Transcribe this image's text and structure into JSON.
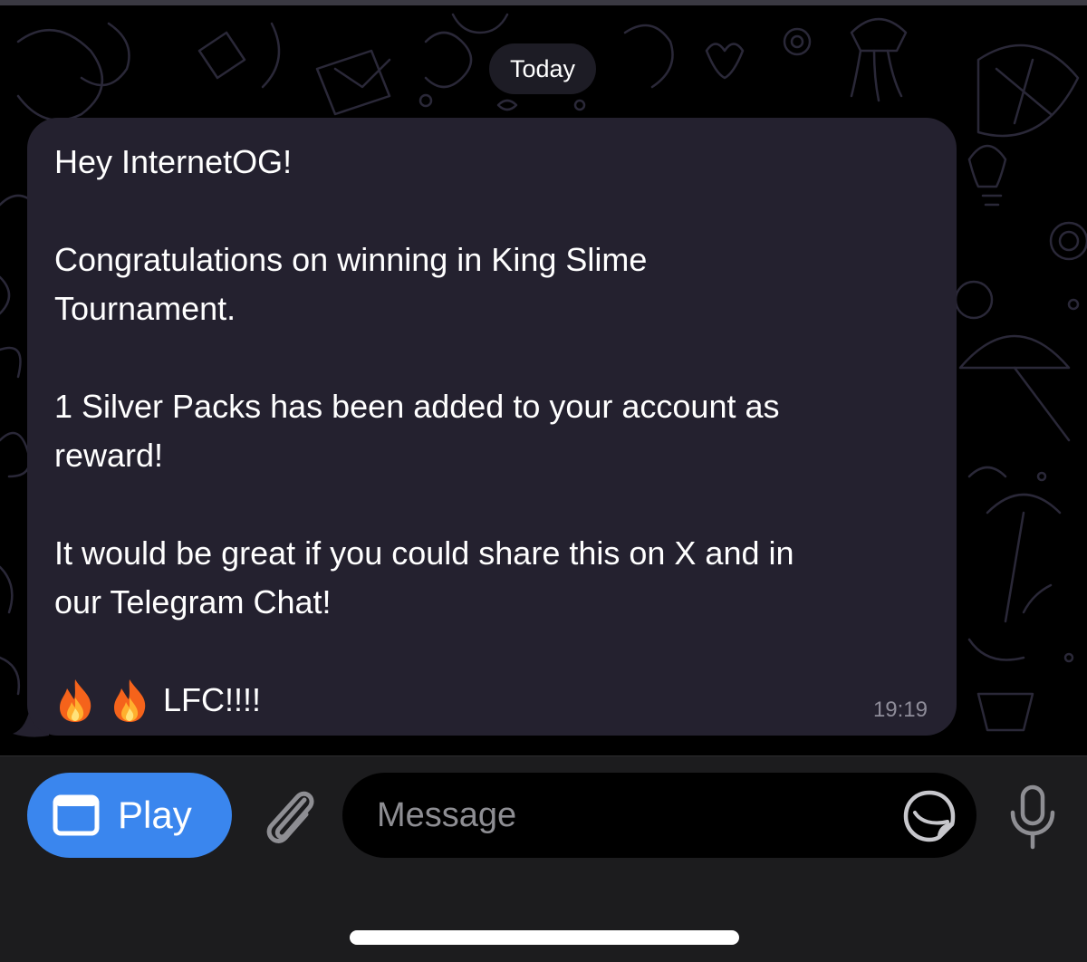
{
  "chat": {
    "date_label": "Today",
    "message": {
      "lines": [
        "Hey InternetOG!",
        "",
        "Congratulations on winning in King Slime",
        "Tournament.",
        "",
        "1 Silver Packs has been added to your account as",
        "reward!",
        "",
        "It would be great if you could share this on X and in",
        "our Telegram Chat!",
        ""
      ],
      "emoji_line_text": "LFC!!!!",
      "emoji_icons": [
        "fire-icon",
        "fire-icon"
      ],
      "time": "19:19"
    }
  },
  "composer": {
    "play_label": "Play",
    "message_placeholder": "Message",
    "icons": {
      "play": "window-icon",
      "attach": "paperclip-icon",
      "sticker": "sticker-icon",
      "mic": "microphone-icon"
    }
  },
  "colors": {
    "bubble": "#24212f",
    "accent": "#3a86ee",
    "date_pill": "#1d1c25",
    "composer_bg": "#1c1c1e"
  }
}
